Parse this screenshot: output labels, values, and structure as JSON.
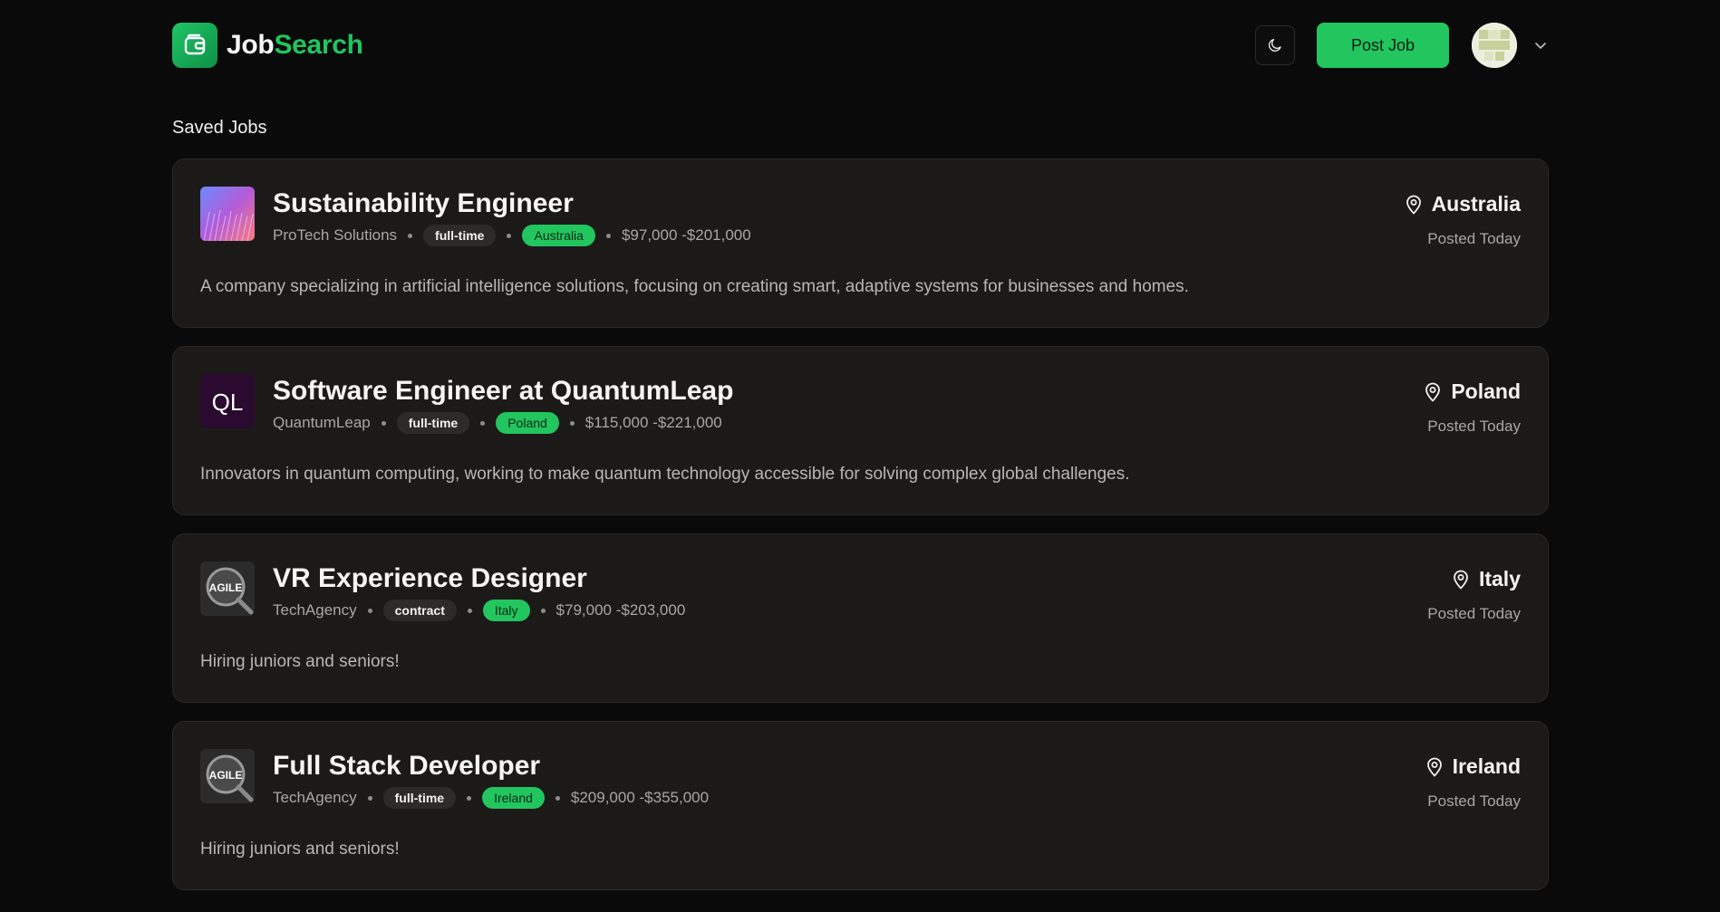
{
  "header": {
    "brand_part1": "Job",
    "brand_part2": "Search",
    "post_job_label": "Post Job"
  },
  "section_title": "Saved Jobs",
  "jobs": [
    {
      "title": "Sustainability Engineer",
      "company": "ProTech Solutions",
      "type": "full-time",
      "location": "Australia",
      "salary": "$97,000 -$201,000",
      "description": "A company specializing in artificial intelligence solutions, focusing on creating smart, adaptive systems for businesses and homes.",
      "location_right": "Australia",
      "posted": "Posted Today",
      "logo": "protech-logo"
    },
    {
      "title": "Software Engineer at QuantumLeap",
      "company": "QuantumLeap",
      "type": "full-time",
      "location": "Poland",
      "salary": "$115,000 -$221,000",
      "description": "Innovators in quantum computing, working to make quantum technology accessible for solving complex global challenges.",
      "location_right": "Poland",
      "posted": "Posted Today",
      "logo": "quantumleap-logo",
      "logo_text": "QL"
    },
    {
      "title": "VR Experience Designer",
      "company": "TechAgency",
      "type": "contract",
      "location": "Italy",
      "salary": "$79,000 -$203,000",
      "description": "Hiring juniors and seniors!",
      "location_right": "Italy",
      "posted": "Posted Today",
      "logo": "techagency-logo",
      "logo_text": "AGILE"
    },
    {
      "title": "Full Stack Developer",
      "company": "TechAgency",
      "type": "full-time",
      "location": "Ireland",
      "salary": "$209,000 -$355,000",
      "description": "Hiring juniors and seniors!",
      "location_right": "Ireland",
      "posted": "Posted Today",
      "logo": "techagency-logo",
      "logo_text": "AGILE"
    }
  ],
  "colors": {
    "accent": "#22c55e",
    "background": "#0a0a0a",
    "card": "#1c1a19"
  }
}
